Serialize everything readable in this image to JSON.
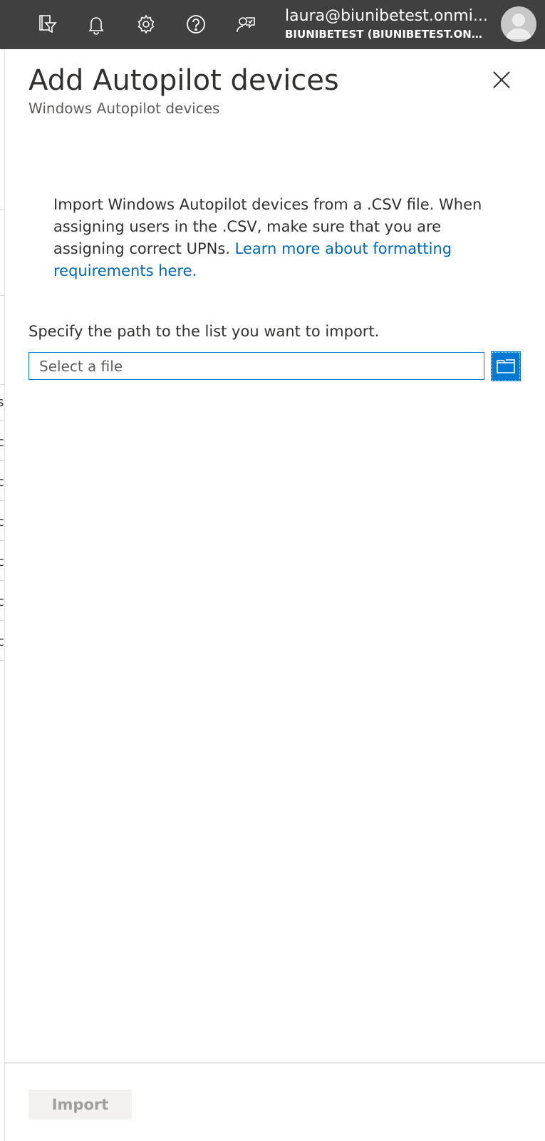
{
  "topbar": {
    "icons": [
      "directory-filter-icon",
      "bell-icon",
      "gear-icon",
      "help-icon",
      "feedback-icon"
    ],
    "account": {
      "email": "laura@biunibetest.onmi...",
      "tenant": "BIUNIBETEST (BIUNIBETEST.ONM..."
    }
  },
  "panel": {
    "title": "Add Autopilot devices",
    "subtitle": "Windows Autopilot devices",
    "info": {
      "text": "Import Windows Autopilot devices from a .CSV file. When assigning users in the .CSV, make sure that you are assigning correct UPNs.",
      "link": "Learn more about formatting requirements here."
    },
    "field_label": "Specify the path to the list you want to import.",
    "file_placeholder": "Select a file",
    "import_label": "Import"
  },
  "colors": {
    "topbar": "#404040",
    "accent": "#0078d4",
    "link": "#0067b8",
    "disabled_text": "#a19f9d"
  }
}
